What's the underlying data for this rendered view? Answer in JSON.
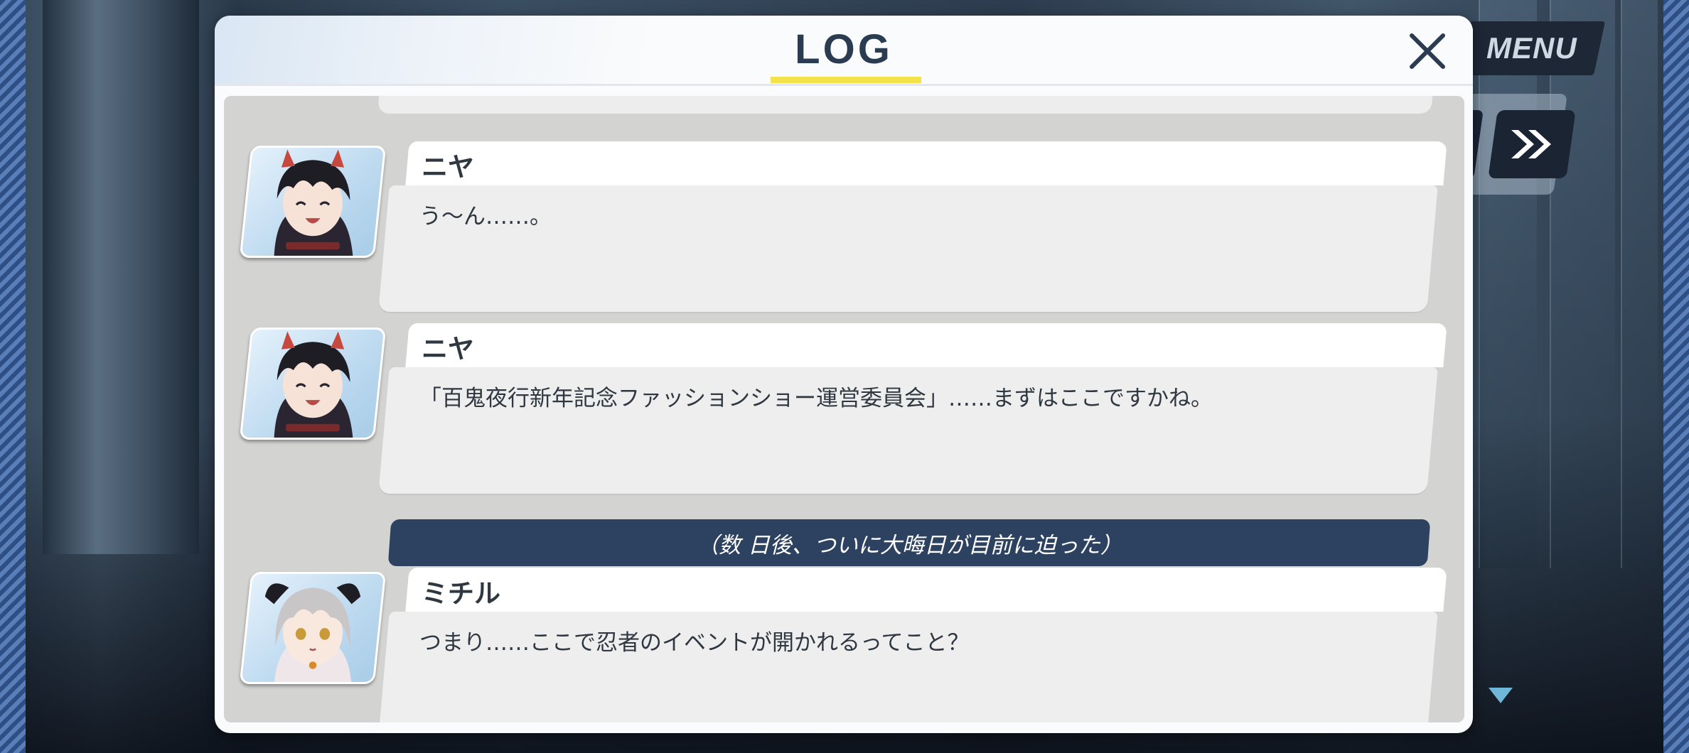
{
  "window": {
    "title": "LOG",
    "close_icon": "close-icon"
  },
  "hud": {
    "menu_label": "MENU",
    "fast_forward_icon": "fast-forward-icon",
    "scroll_indicator_icon": "chevron-down-icon"
  },
  "entries": [
    {
      "speaker": "ニヤ",
      "text": "う〜ん……。"
    },
    {
      "speaker": "ニヤ",
      "text": "「百鬼夜行新年記念ファッションショー運営委員会」……まずはここですかね。"
    },
    {
      "speaker": "ミチル",
      "text": "つまり……ここで忍者のイベントが開かれるってこと？"
    }
  ],
  "narration": "（数 日後、ついに大晦日が目前に迫った）",
  "colors": {
    "accent_yellow": "#f3e24a",
    "title_navy": "#2b3b52",
    "narration_bg": "#2d4261",
    "hud_dark": "#1a2433",
    "scroll_indicator": "#6fb6d8"
  }
}
